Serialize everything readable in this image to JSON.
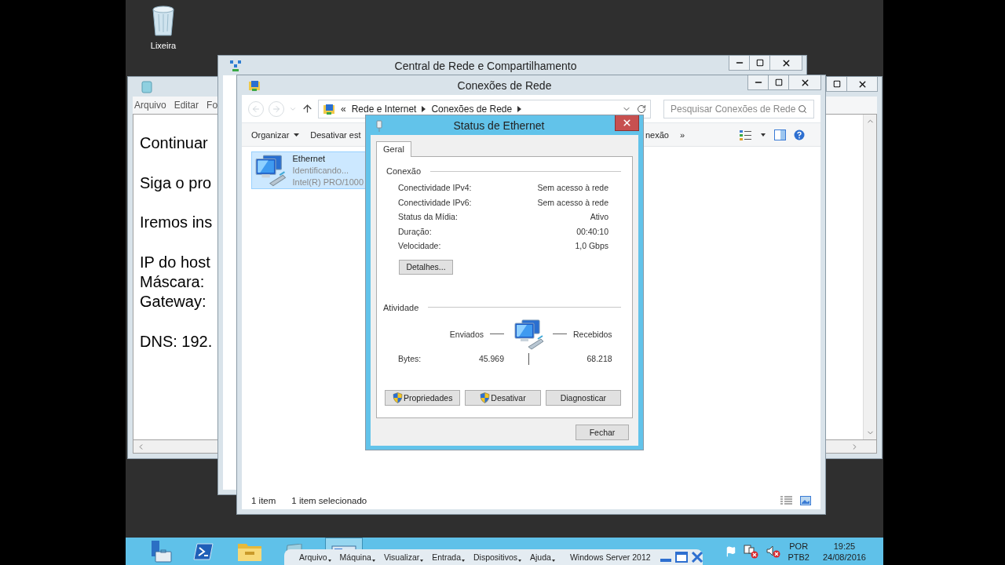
{
  "desktop_icons": [
    {
      "label": "Lixeira"
    }
  ],
  "notepad": {
    "menu": [
      "Arquivo",
      "Editar",
      "Fo"
    ],
    "paragraphs": [
      {
        "lines": [
          "Continuar"
        ]
      },
      {
        "lines": [
          "Siga o pro"
        ]
      },
      {
        "lines": [
          "Iremos ins"
        ]
      },
      {
        "lines": [
          "IP do host",
          "Máscara:",
          "Gateway:"
        ]
      },
      {
        "lines": [
          "DNS: 192."
        ]
      }
    ]
  },
  "network_center": {
    "title": "Central de Rede e Compartilhamento"
  },
  "connections": {
    "title": "Conexões de Rede",
    "address": {
      "overflow": "«",
      "crumbs": [
        "Rede e Internet",
        "Conexões de Rede"
      ]
    },
    "search": {
      "placeholder": "Pesquisar Conexões de Rede"
    },
    "commands_left": [
      {
        "label": "Organizar",
        "dropdown": true
      },
      {
        "label": "Desativar est",
        "dropdown": false
      }
    ],
    "commands_right": [
      {
        "label": "nexão"
      },
      {
        "label": "»"
      }
    ],
    "items": [
      {
        "name": "Ethernet",
        "status": "Identificando...",
        "device": "Intel(R) PRO/1000",
        "selected": true
      }
    ],
    "status_bar": {
      "count": "1 item",
      "selection": "1 item selecionado"
    }
  },
  "status_dialog": {
    "title": "Status de Ethernet",
    "tabs": [
      {
        "label": "Geral",
        "selected": true
      }
    ],
    "connection": {
      "heading": "Conexão",
      "rows": [
        {
          "label": "Conectividade IPv4:",
          "value": "Sem acesso à rede"
        },
        {
          "label": "Conectividade IPv6:",
          "value": "Sem acesso à rede"
        },
        {
          "label": "Status da Mídia:",
          "value": "Ativo"
        },
        {
          "label": "Duração:",
          "value": "00:40:10"
        },
        {
          "label": "Velocidade:",
          "value": "1,0 Gbps"
        }
      ],
      "details_button": "Detalhes..."
    },
    "activity": {
      "heading": "Atividade",
      "sent_label": "Enviados",
      "received_label": "Recebidos",
      "bytes_label": "Bytes:",
      "sent": "45.969",
      "received": "68.218"
    },
    "buttons": [
      {
        "label": "Propriedades",
        "shield": true
      },
      {
        "label": "Desativar",
        "shield": true
      },
      {
        "label": "Diagnosticar",
        "shield": false
      }
    ],
    "close_button": "Fechar"
  },
  "taskbar": {
    "vm_menu": [
      "Arquivo",
      "Máquina",
      "Visualizar",
      "Entrada",
      "Dispositivos",
      "Ajuda"
    ],
    "vm_name": "Windows Server 2012",
    "language": [
      "POR",
      "PTB2"
    ],
    "time": "19:25",
    "date": "24/08/2016"
  }
}
